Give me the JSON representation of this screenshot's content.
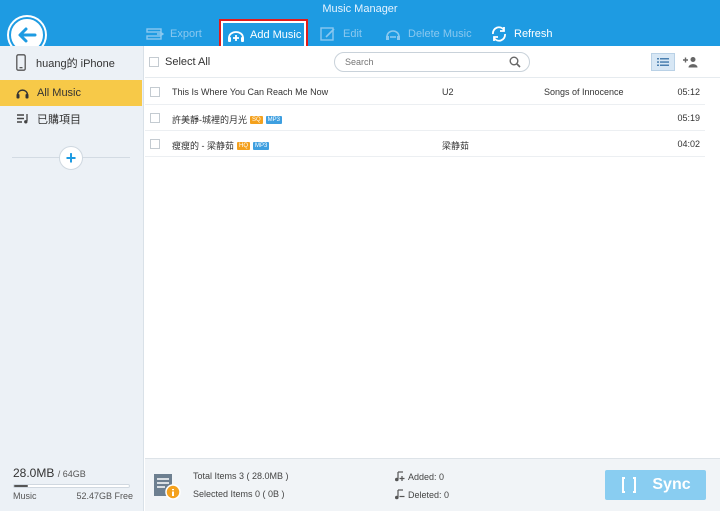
{
  "window": {
    "title": "Music Manager"
  },
  "toolbar": {
    "export_label": "Export",
    "add_music_label": "Add Music",
    "edit_label": "Edit",
    "delete_label": "Delete Music",
    "refresh_label": "Refresh"
  },
  "sidebar": {
    "device_name": "huang的 iPhone",
    "items": [
      {
        "label": "All Music",
        "icon": "headphones-icon",
        "active": true
      },
      {
        "label": "已購項目",
        "icon": "purchased-list-icon",
        "active": false
      }
    ]
  },
  "storage": {
    "used": "28.0MB",
    "total": "/ 64GB",
    "category": "Music",
    "free": "52.47GB Free",
    "used_fraction": 0.12
  },
  "list": {
    "select_all_label": "Select All",
    "search_placeholder": "Search",
    "rows": [
      {
        "title": "This Is Where You Can Reach Me Now",
        "badges": [],
        "artist": "U2",
        "album": "Songs of Innocence",
        "time": "05:12"
      },
      {
        "title": "許美靜-城裡的月光",
        "badges": [
          "SQ",
          "MP3"
        ],
        "artist": "",
        "album": "",
        "time": "05:19"
      },
      {
        "title": "瘦瘦的 - 梁静茹",
        "badges": [
          "HQ",
          "MP3"
        ],
        "artist": "梁静茹",
        "album": "",
        "time": "04:02"
      }
    ]
  },
  "footer": {
    "total_items": "Total Items  3 ( 28.0MB )",
    "selected_items": "Selected Items  0 ( 0B )",
    "added": "Added: 0",
    "deleted": "Deleted: 0",
    "sync_label": "Sync"
  },
  "colors": {
    "accent": "#1e9be2",
    "active_nav": "#f7c948",
    "highlight_border": "#e21b1b",
    "sync_button": "#89cdf1"
  }
}
